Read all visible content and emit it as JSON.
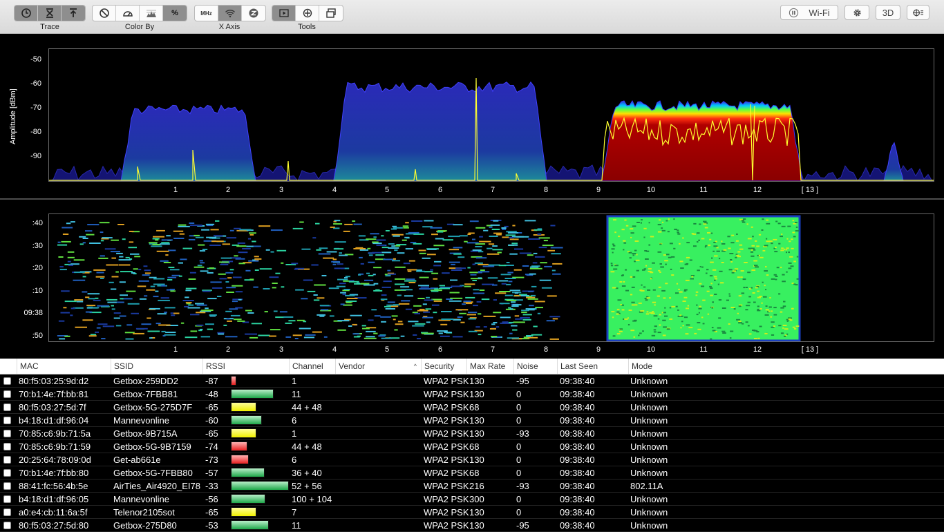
{
  "toolbar": {
    "groups": [
      {
        "label": "Trace"
      },
      {
        "label": "Color By"
      },
      {
        "label": "X Axis"
      },
      {
        "label": "Tools"
      }
    ],
    "xaxis_mhz_label": "MHz",
    "color_by_percent_label": "%",
    "interface_label": "Wi-Fi",
    "view_3d_label": "3D"
  },
  "spectrum": {
    "y_axis_label": "Amplitude [dBm]",
    "y_ticks": [
      "-50",
      "-60",
      "-70",
      "-80",
      "-90"
    ],
    "x_ticks": [
      "1",
      "2",
      "3",
      "4",
      "5",
      "6",
      "7",
      "8",
      "9",
      "10",
      "11",
      "12",
      "[ 13 ]"
    ]
  },
  "waterfall": {
    "y_ticks": [
      ":40",
      ":30",
      ":20",
      ":10",
      "09:38",
      ":50"
    ],
    "x_ticks": [
      "1",
      "2",
      "3",
      "4",
      "5",
      "6",
      "7",
      "8",
      "9",
      "10",
      "11",
      "12",
      "[ 13 ]"
    ]
  },
  "table": {
    "columns": [
      "MAC",
      "SSID",
      "RSSI",
      "Channel",
      "Vendor",
      "Security",
      "Max Rate",
      "Noise",
      "Last Seen",
      "Mode"
    ],
    "sort_indicator": "^",
    "rows": [
      {
        "mac": "80:f5:03:25:9d:d2",
        "ssid": "Getbox-259DD2",
        "rssi": "-87",
        "channel": "1",
        "vendor": "",
        "security": "WPA2 PSK",
        "max_rate": "130",
        "noise": "-95",
        "last_seen": "09:38:40",
        "mode": "Unknown"
      },
      {
        "mac": "70:b1:4e:7f:bb:81",
        "ssid": "Getbox-7FBB81",
        "rssi": "-48",
        "channel": "11",
        "vendor": "",
        "security": "WPA2 PSK",
        "max_rate": "130",
        "noise": "0",
        "last_seen": "09:38:40",
        "mode": "Unknown"
      },
      {
        "mac": "80:f5:03:27:5d:7f",
        "ssid": "Getbox-5G-275D7F",
        "rssi": "-65",
        "channel": "44 + 48",
        "vendor": "",
        "security": "WPA2 PSK",
        "max_rate": "68",
        "noise": "0",
        "last_seen": "09:38:40",
        "mode": "Unknown"
      },
      {
        "mac": "b4:18:d1:df:96:04",
        "ssid": "Mannevonline",
        "rssi": "-60",
        "channel": "6",
        "vendor": "",
        "security": "WPA2 PSK",
        "max_rate": "130",
        "noise": "0",
        "last_seen": "09:38:40",
        "mode": "Unknown"
      },
      {
        "mac": "70:85:c6:9b:71:5a",
        "ssid": "Getbox-9B715A",
        "rssi": "-65",
        "channel": "1",
        "vendor": "",
        "security": "WPA2 PSK",
        "max_rate": "130",
        "noise": "-93",
        "last_seen": "09:38:40",
        "mode": "Unknown"
      },
      {
        "mac": "70:85:c6:9b:71:59",
        "ssid": "Getbox-5G-9B7159",
        "rssi": "-74",
        "channel": "44 + 48",
        "vendor": "",
        "security": "WPA2 PSK",
        "max_rate": "68",
        "noise": "0",
        "last_seen": "09:38:40",
        "mode": "Unknown"
      },
      {
        "mac": "20:25:64:78:09:0d",
        "ssid": "Get-ab661e",
        "rssi": "-73",
        "channel": "6",
        "vendor": "",
        "security": "WPA2 PSK",
        "max_rate": "130",
        "noise": "0",
        "last_seen": "09:38:40",
        "mode": "Unknown"
      },
      {
        "mac": "70:b1:4e:7f:bb:80",
        "ssid": "Getbox-5G-7FBB80",
        "rssi": "-57",
        "channel": "36 + 40",
        "vendor": "",
        "security": "WPA2 PSK",
        "max_rate": "68",
        "noise": "0",
        "last_seen": "09:38:40",
        "mode": "Unknown"
      },
      {
        "mac": "88:41:fc:56:4b:5e",
        "ssid": "AirTies_Air4920_EI78",
        "rssi": "-33",
        "channel": "52 + 56",
        "vendor": "",
        "security": "WPA2 PSK",
        "max_rate": "216",
        "noise": "-93",
        "last_seen": "09:38:40",
        "mode": "802.11A"
      },
      {
        "mac": "b4:18:d1:df:96:05",
        "ssid": "Mannevonline",
        "rssi": "-56",
        "channel": "100 + 104",
        "vendor": "",
        "security": "WPA2 PSK",
        "max_rate": "300",
        "noise": "0",
        "last_seen": "09:38:40",
        "mode": "Unknown"
      },
      {
        "mac": "a0:e4:cb:11:6a:5f",
        "ssid": "Telenor2105sot",
        "rssi": "-65",
        "channel": "7",
        "vendor": "",
        "security": "WPA2 PSK",
        "max_rate": "130",
        "noise": "0",
        "last_seen": "09:38:40",
        "mode": "Unknown"
      },
      {
        "mac": "80:f5:03:27:5d:80",
        "ssid": "Getbox-275D80",
        "rssi": "-53",
        "channel": "11",
        "vendor": "",
        "security": "WPA2 PSK",
        "max_rate": "130",
        "noise": "-95",
        "last_seen": "09:38:40",
        "mode": "Unknown"
      }
    ]
  }
}
